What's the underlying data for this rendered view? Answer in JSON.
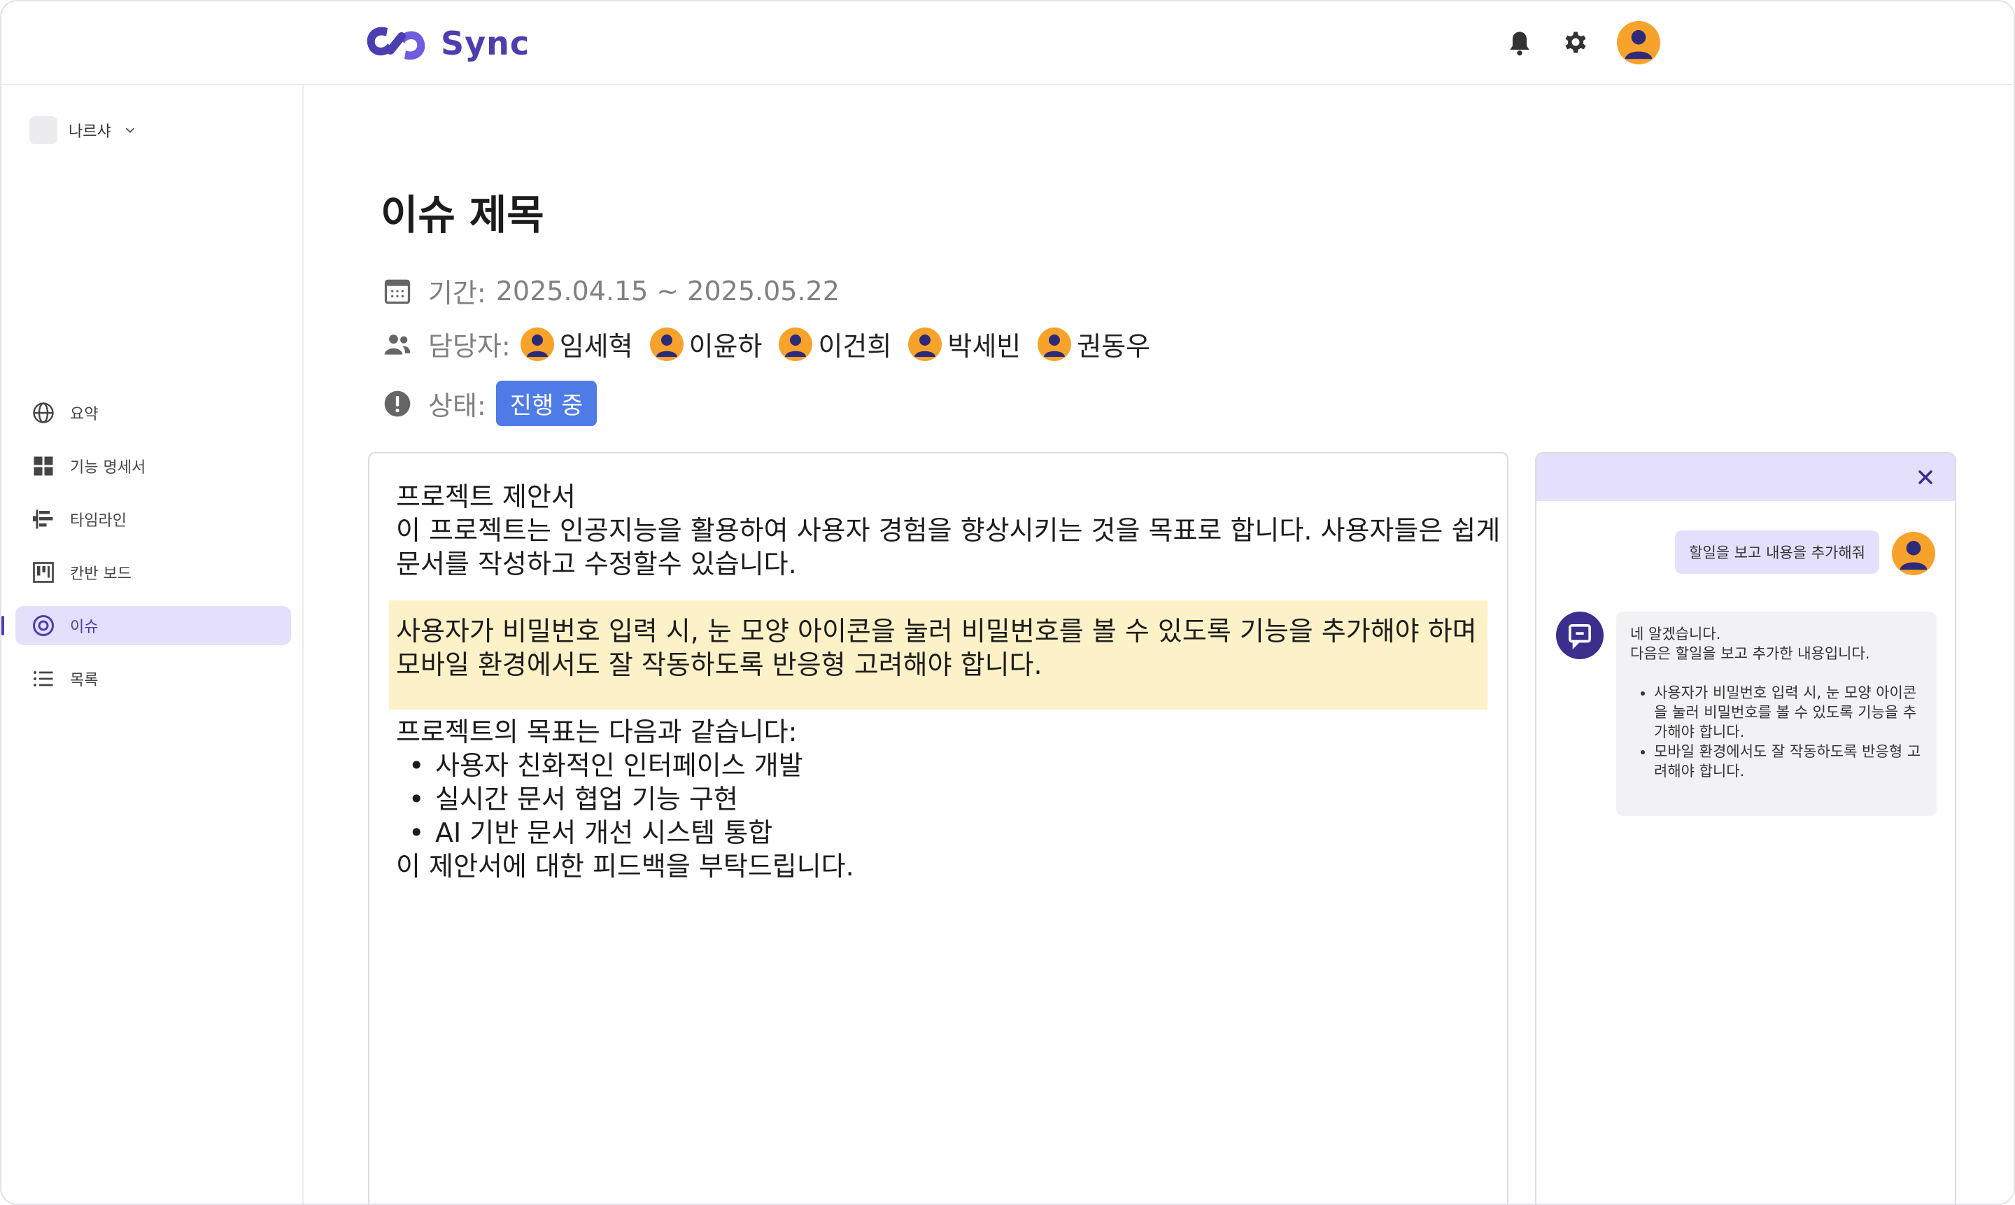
{
  "header": {
    "brand": "Sync",
    "notification_icon": "bell-icon",
    "settings_icon": "gear-icon",
    "avatar_icon": "user-avatar-icon",
    "brand_color": "#4b3fb0"
  },
  "sidebar": {
    "workspace": "나르샤",
    "items": [
      {
        "label": "요약",
        "icon": "globe-icon"
      },
      {
        "label": "기능 명세서",
        "icon": "grid-icon"
      },
      {
        "label": "타임라인",
        "icon": "timeline-icon"
      },
      {
        "label": "칸반 보드",
        "icon": "kanban-icon"
      },
      {
        "label": "이슈",
        "icon": "target-icon",
        "active": true
      },
      {
        "label": "목록",
        "icon": "list-icon"
      }
    ]
  },
  "issue": {
    "title": "이슈 제목",
    "period_label": "기간:",
    "period_value": "2025.04.15 ~ 2025.05.22",
    "assignees_label": "담당자:",
    "assignees": [
      "임세혁",
      "이윤하",
      "이건희",
      "박세빈",
      "권동우"
    ],
    "status_label": "상태:",
    "status_value": "진행 중",
    "status_color": "#4e7be6"
  },
  "editor": {
    "heading": "프로젝트 제안서",
    "intro_line1": "이 프로젝트는 인공지능을 활용하여 사용자 경험을 향상시키는 것을 목표로 합니다. 사용자들은 쉽게",
    "intro_line2": "문서를 작성하고 수정할수 있습니다.",
    "highlight_line1": "사용자가 비밀번호 입력 시, 눈 모양 아이콘을 눌러 비밀번호를 볼 수 있도록 기능을 추가해야 하며",
    "highlight_line2": "모바일 환경에서도 잘 작동하도록 반응형 고려해야 합니다.",
    "highlight_color": "#fdf1c8",
    "goals_heading": "프로젝트의 목표는 다음과 같습니다:",
    "goals": [
      "사용자 친화적인 인터페이스 개발",
      "실시간 문서 협업 기능 구현",
      "AI 기반 문서 개선 시스템 통합"
    ],
    "closing": "이 제안서에 대한 피드백을 부탁드립니다."
  },
  "chat": {
    "close_icon": "close-icon",
    "user_message": "할일을 보고 내용을 추가해줘",
    "bot_icon": "chat-bot-icon",
    "bot_line1": "네 알겠습니다.",
    "bot_line2": "다음은 할일을 보고 추가한 내용입니다.",
    "bot_items": [
      "사용자가 비밀번호 입력 시, 눈 모양 아이콘을 눌러 비밀번호를 볼 수 있도록 기능을 추가해야 합니다.",
      "모바일 환경에서도 잘 작동하도록 반응형 고려해야 합니다."
    ]
  }
}
